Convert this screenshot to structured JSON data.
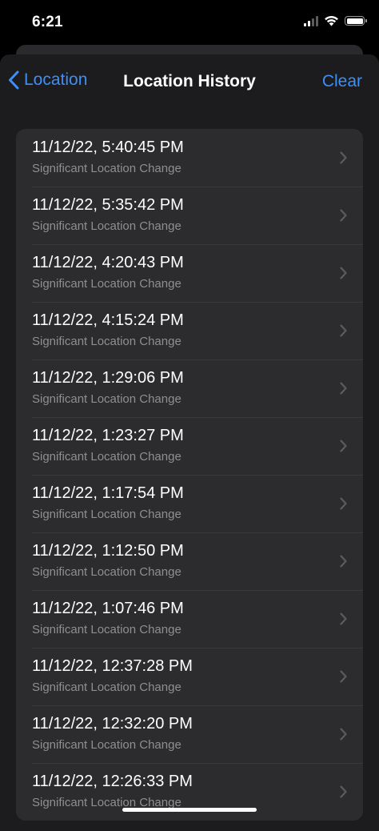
{
  "status_bar": {
    "time": "6:21",
    "icons": [
      "cellular-signal-icon",
      "wifi-icon",
      "battery-icon"
    ]
  },
  "nav": {
    "back_label": "Location",
    "title": "Location History",
    "clear_label": "Clear"
  },
  "colors": {
    "accent": "#3d8ff5",
    "background": "#000000",
    "sheet": "#1c1c1e",
    "cell": "#2c2c2e",
    "secondary_text": "#8e8e93"
  },
  "history": [
    {
      "timestamp": "11/12/22, 5:40:45 PM",
      "type": "Significant Location Change"
    },
    {
      "timestamp": "11/12/22, 5:35:42 PM",
      "type": "Significant Location Change"
    },
    {
      "timestamp": "11/12/22, 4:20:43 PM",
      "type": "Significant Location Change"
    },
    {
      "timestamp": "11/12/22, 4:15:24 PM",
      "type": "Significant Location Change"
    },
    {
      "timestamp": "11/12/22, 1:29:06 PM",
      "type": "Significant Location Change"
    },
    {
      "timestamp": "11/12/22, 1:23:27 PM",
      "type": "Significant Location Change"
    },
    {
      "timestamp": "11/12/22, 1:17:54 PM",
      "type": "Significant Location Change"
    },
    {
      "timestamp": "11/12/22, 1:12:50 PM",
      "type": "Significant Location Change"
    },
    {
      "timestamp": "11/12/22, 1:07:46 PM",
      "type": "Significant Location Change"
    },
    {
      "timestamp": "11/12/22, 12:37:28 PM",
      "type": "Significant Location Change"
    },
    {
      "timestamp": "11/12/22, 12:32:20 PM",
      "type": "Significant Location Change"
    },
    {
      "timestamp": "11/12/22, 12:26:33 PM",
      "type": "Significant Location Change"
    }
  ]
}
